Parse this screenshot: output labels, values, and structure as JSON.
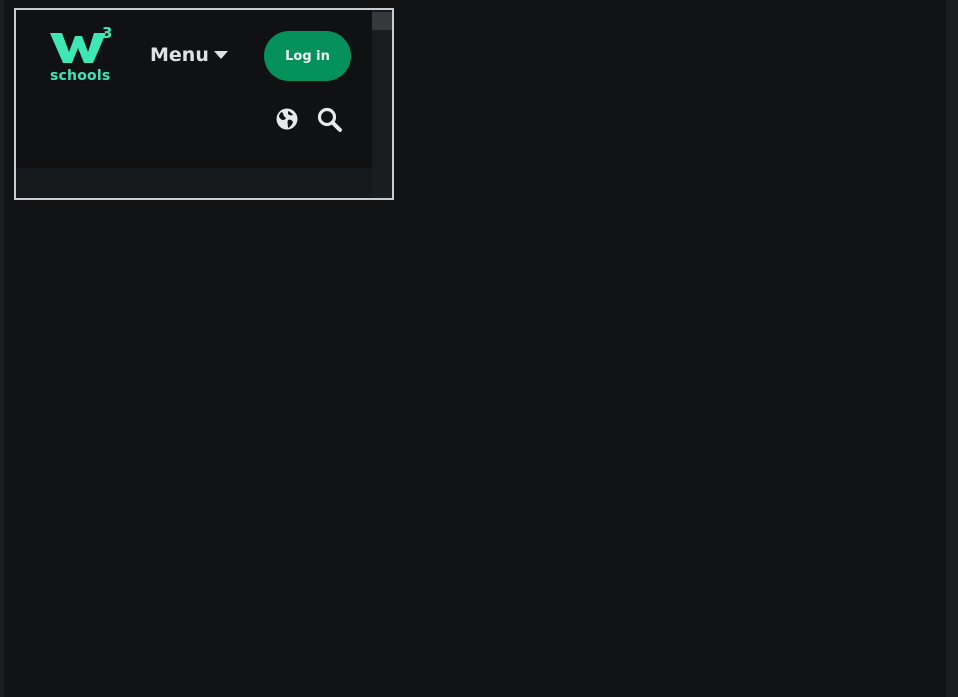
{
  "header": {
    "logo": {
      "text": "schools",
      "superscript": "3",
      "brand_color": "#3ee8b5"
    },
    "menu_label": "Menu",
    "login_label": "Log in",
    "icons": {
      "language": "globe-icon",
      "search": "search-icon",
      "menu_caret": "chevron-down-icon"
    },
    "colors": {
      "background": "#101214",
      "login_button": "#04915c",
      "text": "#dfe2e5"
    }
  }
}
